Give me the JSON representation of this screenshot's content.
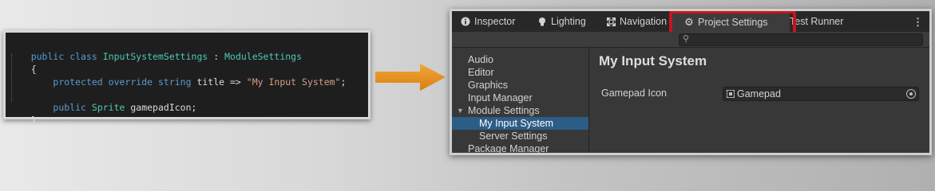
{
  "code": {
    "lines": [
      [
        {
          "t": "public",
          "c": "kw"
        },
        {
          "t": " ",
          "c": "pl"
        },
        {
          "t": "class",
          "c": "kw"
        },
        {
          "t": " ",
          "c": "pl"
        },
        {
          "t": "InputSystemSettings",
          "c": "ty"
        },
        {
          "t": " : ",
          "c": "pl"
        },
        {
          "t": "ModuleSettings",
          "c": "ty"
        }
      ],
      [
        {
          "t": "{",
          "c": "pl"
        }
      ],
      [
        {
          "t": "    ",
          "c": "pl"
        },
        {
          "t": "protected",
          "c": "kw"
        },
        {
          "t": " ",
          "c": "pl"
        },
        {
          "t": "override",
          "c": "kw"
        },
        {
          "t": " ",
          "c": "pl"
        },
        {
          "t": "string",
          "c": "kw"
        },
        {
          "t": " title => ",
          "c": "pl"
        },
        {
          "t": "\"My Input System\"",
          "c": "st"
        },
        {
          "t": ";",
          "c": "pl"
        }
      ],
      [
        {
          "t": "",
          "c": "pl"
        }
      ],
      [
        {
          "t": "    ",
          "c": "pl"
        },
        {
          "t": "public",
          "c": "kw"
        },
        {
          "t": " ",
          "c": "pl"
        },
        {
          "t": "Sprite",
          "c": "ty"
        },
        {
          "t": " gamepadIcon;",
          "c": "pl"
        }
      ],
      [
        {
          "t": "}",
          "c": "pl"
        }
      ]
    ]
  },
  "colors": {
    "arrow": "#e8961e",
    "highlight": "#c8141e",
    "selection": "#2c5d87"
  },
  "tabs": [
    {
      "label": "Inspector",
      "icon": "info-icon"
    },
    {
      "label": "Lighting",
      "icon": "bulb-icon"
    },
    {
      "label": "Navigation",
      "icon": "navigation-icon"
    },
    {
      "label": "Project Settings",
      "icon": "gear-icon",
      "active": true
    },
    {
      "label": "Test Runner",
      "icon": "test-runner-icon"
    }
  ],
  "sidebar": {
    "items": [
      {
        "label": "Audio"
      },
      {
        "label": "Editor"
      },
      {
        "label": "Graphics"
      },
      {
        "label": "Input Manager"
      },
      {
        "label": "Module Settings",
        "expanded": true
      },
      {
        "label": "My Input System",
        "child": true,
        "selected": true
      },
      {
        "label": "Server Settings",
        "child": true
      },
      {
        "label": "Package Manager"
      }
    ]
  },
  "main": {
    "title": "My Input System",
    "property": {
      "label": "Gamepad Icon",
      "value": "Gamepad",
      "icon": "sprite-icon"
    }
  }
}
